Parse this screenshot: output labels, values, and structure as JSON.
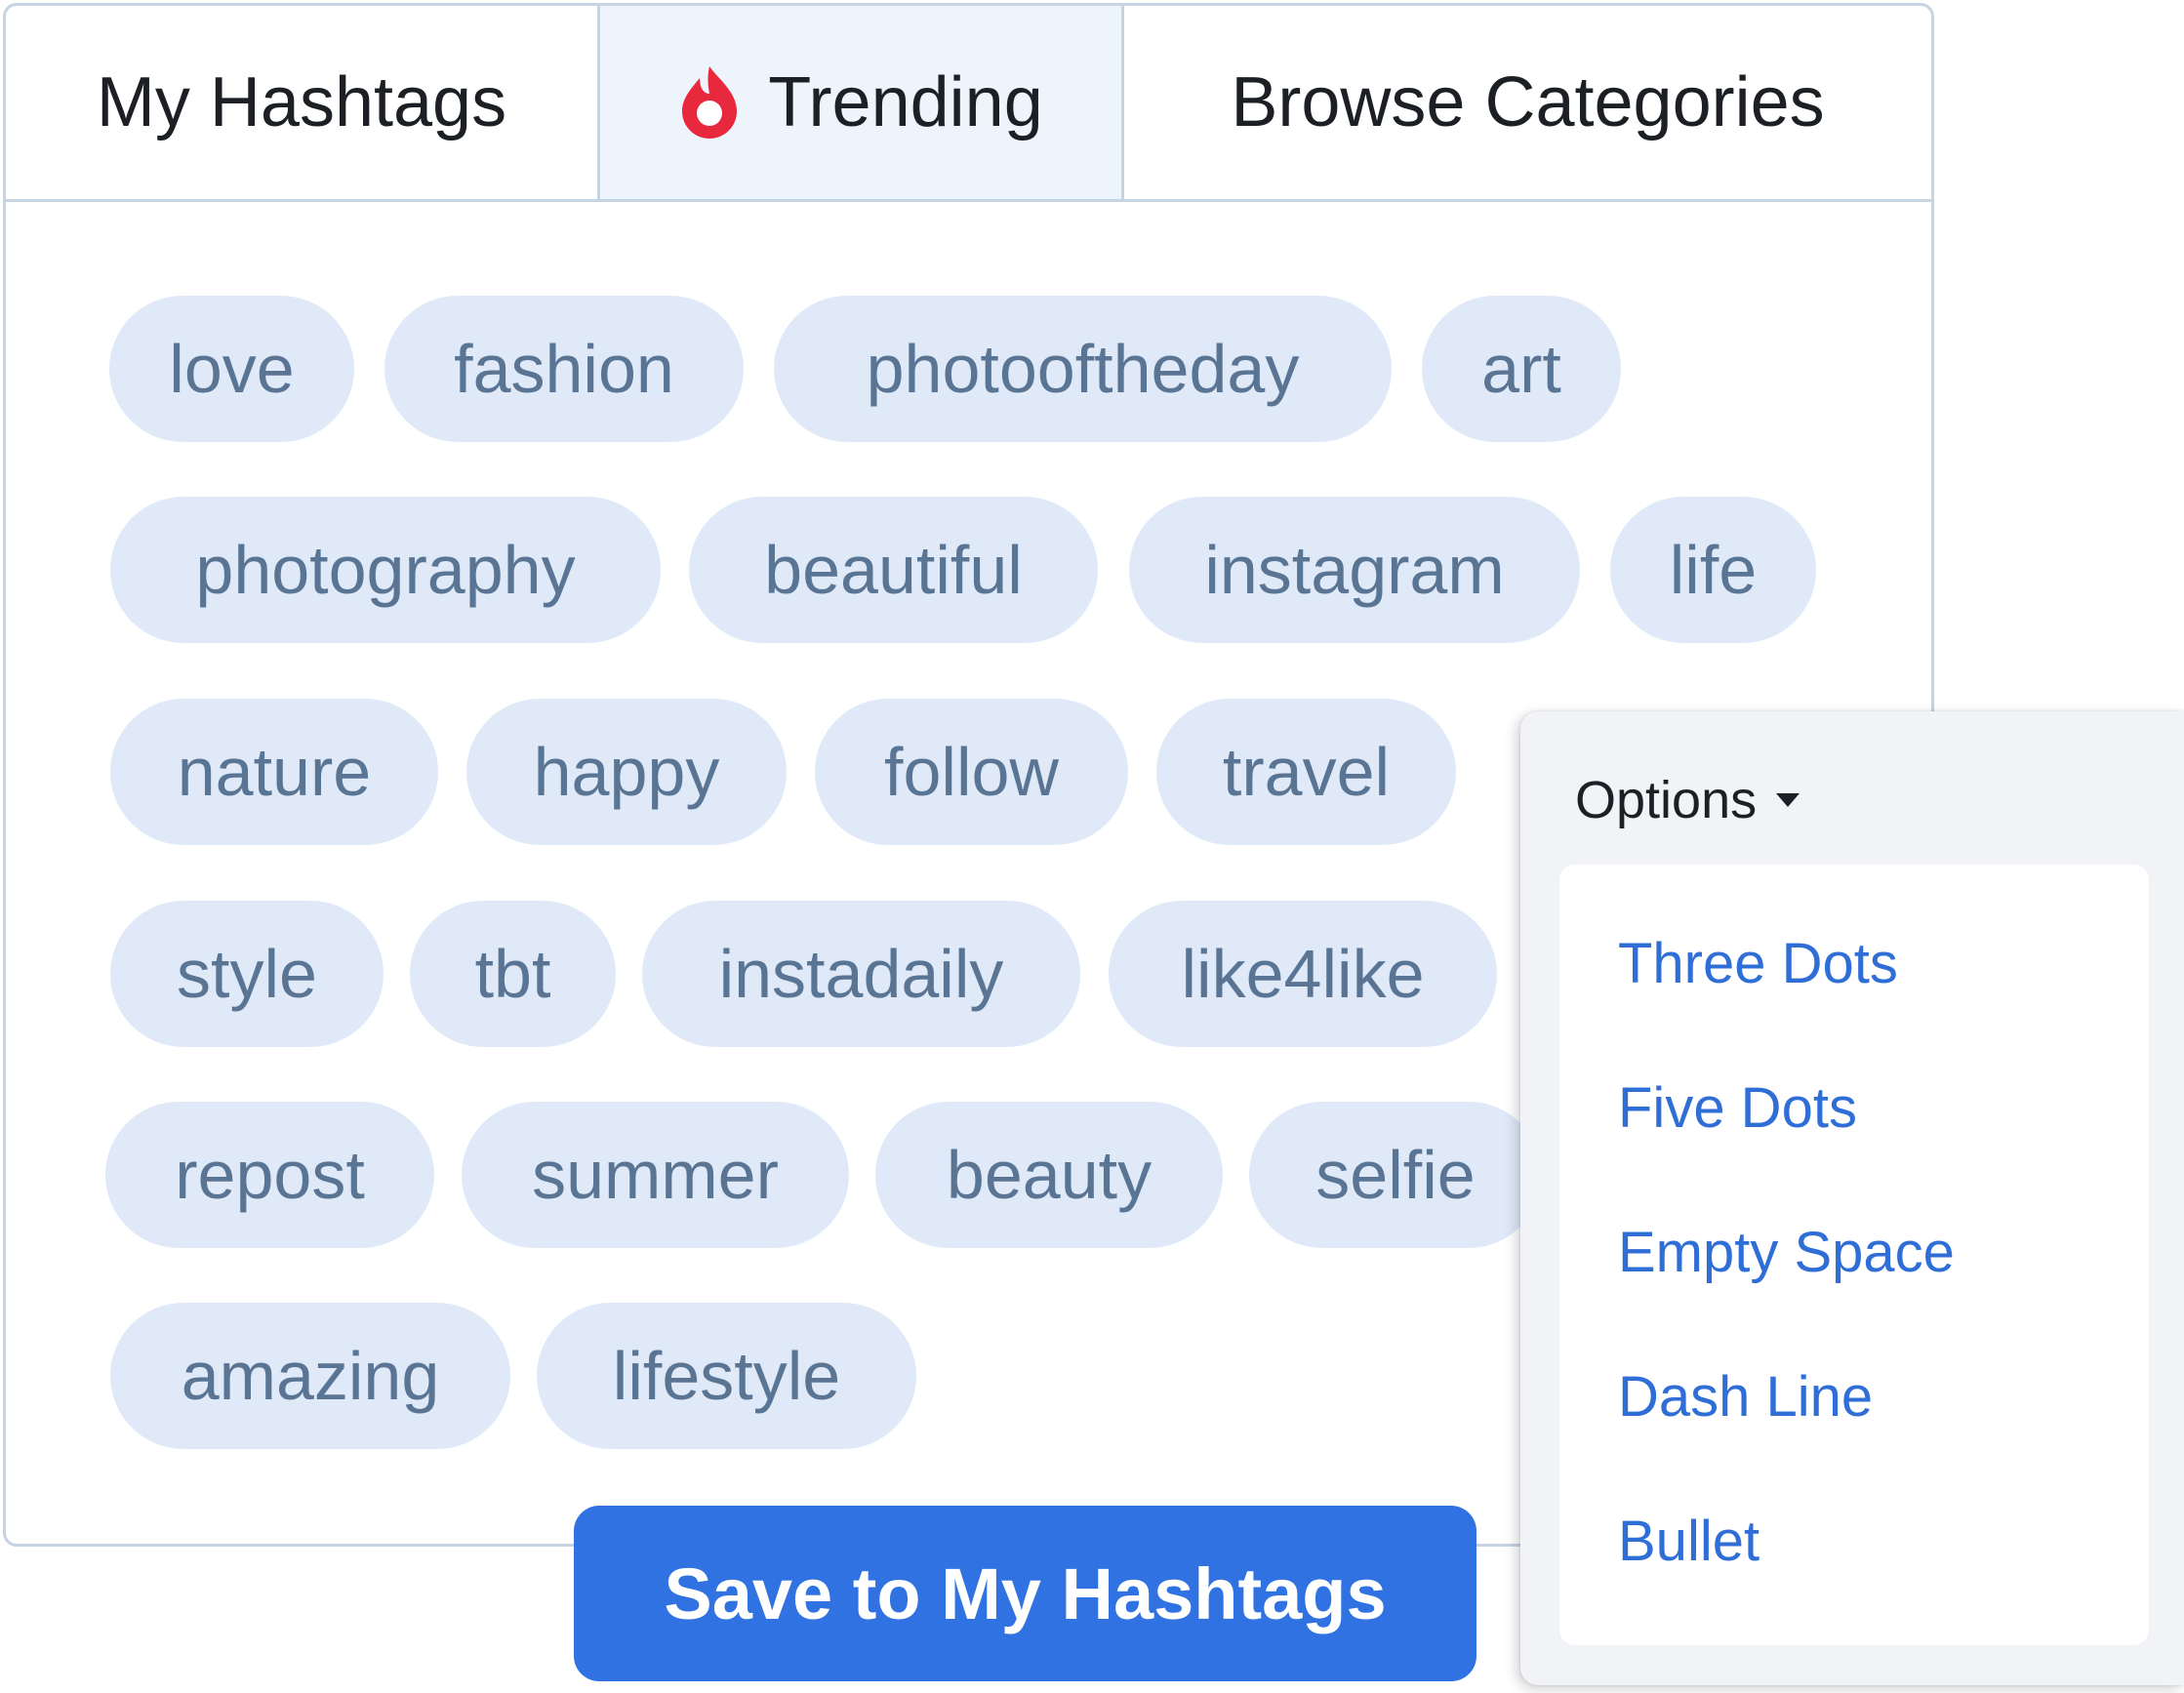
{
  "tabs": {
    "my_hashtags": "My Hashtags",
    "trending": "Trending",
    "browse_categories": "Browse Categories"
  },
  "hashtags": [
    "love",
    "fashion",
    "photooftheday",
    "art",
    "photography",
    "beautiful",
    "instagram",
    "life",
    "nature",
    "happy",
    "follow",
    "travel",
    "style",
    "tbt",
    "instadaily",
    "like4like",
    "repost",
    "summer",
    "beauty",
    "selfie",
    "amazing",
    "lifestyle"
  ],
  "save_button": "Save to My Hashtags",
  "options": {
    "label": "Options",
    "items": [
      "Three Dots",
      "Five Dots",
      "Empty Space",
      "Dash Line",
      "Bullet"
    ]
  },
  "colors": {
    "accent": "#3072e2",
    "chip_bg": "#dfe9f8",
    "chip_text": "#5a7593",
    "flame": "#e8283c",
    "link": "#2f6ed6"
  },
  "icons": {
    "trending": "flame-icon",
    "options": "caret-down-icon"
  }
}
